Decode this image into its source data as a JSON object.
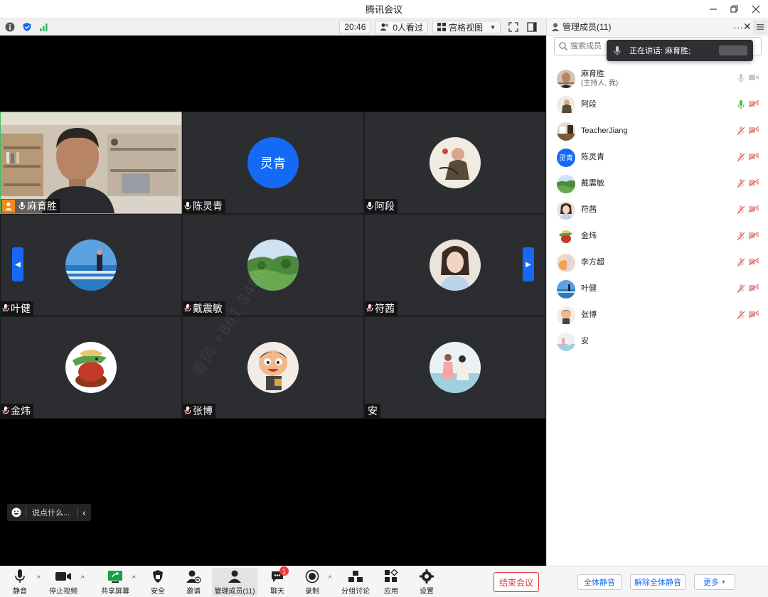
{
  "window": {
    "title": "腾讯会议"
  },
  "infobar": {
    "time": "20:46",
    "viewers": "0人看过",
    "view_mode": "宫格视图"
  },
  "grid": {
    "tiles": [
      {
        "name": "麻育胜",
        "type": "video",
        "host": true,
        "mic": "on",
        "active": true
      },
      {
        "name": "陈灵青",
        "type": "text",
        "avatar_text": "灵青",
        "mic": "on"
      },
      {
        "name": "阿段",
        "type": "image",
        "avatar": "ink-painting",
        "mic": "on"
      },
      {
        "name": "叶健",
        "type": "image",
        "avatar": "sea-railing",
        "mic": "off"
      },
      {
        "name": "戴震敏",
        "type": "image",
        "avatar": "green-valley",
        "mic": "off"
      },
      {
        "name": "符茜",
        "type": "image",
        "avatar": "girl-portrait",
        "mic": "off"
      },
      {
        "name": "金炜",
        "type": "image",
        "avatar": "cartoon-crocodile",
        "mic": "off"
      },
      {
        "name": "张博",
        "type": "image",
        "avatar": "cartoon-face",
        "mic": "off"
      },
      {
        "name": "安",
        "type": "image",
        "avatar": "seaside-girls",
        "mic": "none"
      }
    ],
    "watermark": "清风 +861 3406868"
  },
  "chat": {
    "placeholder": "说点什么..."
  },
  "toolbar": {
    "mute": "静音",
    "stop_video": "停止视频",
    "share_screen": "共享屏幕",
    "security": "安全",
    "invite": "邀请",
    "manage_members": "管理成员(11)",
    "chat": "聊天",
    "chat_badge": "1",
    "record": "录制",
    "breakout": "分组讨论",
    "apps": "应用",
    "settings": "设置",
    "end_meeting": "结束会议"
  },
  "panel": {
    "title": "管理成员(11)",
    "search_placeholder": "搜索成员",
    "speaking_label": "正在讲话: 麻育胜;",
    "members": [
      {
        "name": "麻育胜",
        "sub": "(主持人, 我)",
        "avatar": "video-host",
        "mic": "gray",
        "cam": "gray"
      },
      {
        "name": "阿段",
        "sub": "",
        "avatar": "ink-painting",
        "mic": "green",
        "cam": "off"
      },
      {
        "name": "TeacherJiang",
        "sub": "",
        "avatar": "room",
        "mic": "off",
        "cam": "off"
      },
      {
        "name": "陈灵青",
        "sub": "",
        "avatar": "text",
        "avatar_text": "灵青",
        "mic": "off",
        "cam": "off"
      },
      {
        "name": "戴震敏",
        "sub": "",
        "avatar": "green-valley",
        "mic": "off",
        "cam": "off"
      },
      {
        "name": "符茜",
        "sub": "",
        "avatar": "girl-portrait",
        "mic": "off",
        "cam": "off"
      },
      {
        "name": "金炜",
        "sub": "",
        "avatar": "cartoon-crocodile",
        "mic": "off",
        "cam": "off"
      },
      {
        "name": "李方超",
        "sub": "",
        "avatar": "sunset",
        "mic": "off",
        "cam": "off"
      },
      {
        "name": "叶健",
        "sub": "",
        "avatar": "sea-railing",
        "mic": "off",
        "cam": "off"
      },
      {
        "name": "张博",
        "sub": "",
        "avatar": "cartoon-face",
        "mic": "off",
        "cam": "off"
      },
      {
        "name": "安",
        "sub": "",
        "avatar": "seaside-girls",
        "mic": "none",
        "cam": "none"
      }
    ],
    "mute_all": "全体静音",
    "unmute_all": "解除全体静音",
    "more": "更多"
  },
  "colors": {
    "accent": "#1469f5",
    "active_border": "#3fbf5f",
    "danger": "#e0393e",
    "host_badge": "#f28a1a"
  }
}
